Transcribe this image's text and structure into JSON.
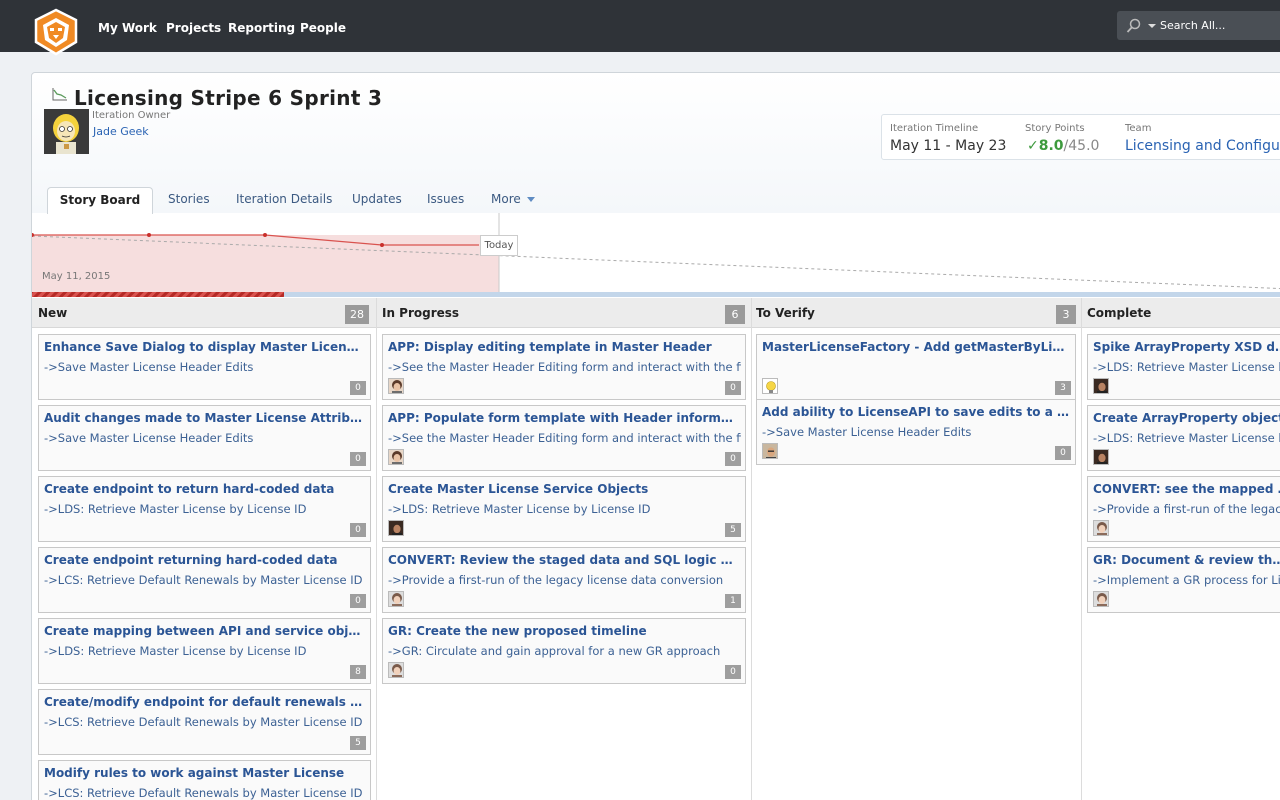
{
  "nav": {
    "items": [
      "My Work",
      "Projects",
      "Reporting",
      "People"
    ],
    "search_placeholder": "Search All..."
  },
  "iteration": {
    "title": "Licensing Stripe 6 Sprint 3",
    "owner_label": "Iteration Owner",
    "owner_name": "Jade Geek"
  },
  "info": {
    "timeline_label": "Iteration Timeline",
    "timeline_value": "May 11 - May 23",
    "points_label": "Story Points",
    "points_done": "8.0",
    "points_total": "/45.0",
    "team_label": "Team",
    "team_value": "Licensing and Configuration"
  },
  "tabs": [
    "Story Board",
    "Stories",
    "Iteration Details",
    "Updates",
    "Issues",
    "More"
  ],
  "burndown": {
    "today_label": "Today",
    "start_date": "May 11, 2015"
  },
  "colors": {
    "accent_link": "#2b5595",
    "nav_bg": "#2f3338",
    "logo_orange": "#f08a24",
    "burndown_red": "#d9534f",
    "points_green": "#3d9a3d"
  },
  "columns": [
    {
      "title": "New",
      "count": "28",
      "cards": [
        {
          "title": "Enhance Save Dialog to display Master License edit...",
          "parent": "->Save Master License Header Edits",
          "points": "0",
          "avatar": ""
        },
        {
          "title": "Audit changes made to Master License Attributes",
          "parent": "->Save Master License Header Edits",
          "points": "0",
          "avatar": ""
        },
        {
          "title": "Create endpoint to return hard-coded data",
          "parent": "->LDS: Retrieve Master License by License ID",
          "points": "0",
          "avatar": ""
        },
        {
          "title": "Create endpoint returning hard-coded data",
          "parent": "->LCS: Retrieve Default Renewals by Master License ID",
          "points": "0",
          "avatar": ""
        },
        {
          "title": "Create mapping between API and service objects",
          "parent": "->LDS: Retrieve Master License by License ID",
          "points": "8",
          "avatar": ""
        },
        {
          "title": "Create/modify endpoint for default renewals for ...",
          "parent": "->LCS: Retrieve Default Renewals by Master License ID",
          "points": "5",
          "avatar": ""
        },
        {
          "title": "Modify rules to work against Master License",
          "parent": "->LCS: Retrieve Default Renewals by Master License ID",
          "points": "",
          "avatar": ""
        }
      ]
    },
    {
      "title": "In Progress",
      "count": "6",
      "cards": [
        {
          "title": "APP: Display editing template in Master Header",
          "parent": "->See the Master Header Editing form and interact with the fields",
          "points": "0",
          "avatar": "woman"
        },
        {
          "title": "APP: Populate form template with Header information",
          "parent": "->See the Master Header Editing form and interact with the fields",
          "points": "0",
          "avatar": "woman"
        },
        {
          "title": "Create Master License Service Objects",
          "parent": "->LDS: Retrieve Master License by License ID",
          "points": "5",
          "avatar": "man-dark"
        },
        {
          "title": "CONVERT: Review the staged data and SQL logic with ...",
          "parent": "->Provide a first-run of the legacy license data conversion",
          "points": "1",
          "avatar": "woman-light"
        },
        {
          "title": "GR: Create the new proposed timeline",
          "parent": "->GR: Circulate and gain approval for a new GR approach",
          "points": "0",
          "avatar": "woman-light"
        }
      ]
    },
    {
      "title": "To Verify",
      "count": "3",
      "cards": [
        {
          "title": "MasterLicenseFactory - Add getMasterByLicenseId",
          "parent": "",
          "points": "3",
          "avatar": "bulb"
        },
        {
          "title": "Add ability to LicenseAPI to save edits to a mast...",
          "parent": "->Save Master License Header Edits",
          "points": "0",
          "avatar": "man-glasses"
        }
      ]
    },
    {
      "title": "Complete",
      "count": "",
      "cards": [
        {
          "title": "Spike ArrayProperty XSD definition",
          "parent": "->LDS: Retrieve Master License by License ID",
          "points": "",
          "avatar": "man-dark"
        },
        {
          "title": "Create ArrayProperty object",
          "parent": "->LDS: Retrieve Master License by License ID",
          "points": "",
          "avatar": "man-dark"
        },
        {
          "title": "CONVERT: see the mapped data",
          "parent": "->Provide a first-run of the legacy license data conversion",
          "points": "",
          "avatar": "woman-light"
        },
        {
          "title": "GR: Document & review the legacy GR process",
          "parent": "->Implement a GR process for License",
          "points": "",
          "avatar": "woman-light"
        }
      ]
    }
  ]
}
